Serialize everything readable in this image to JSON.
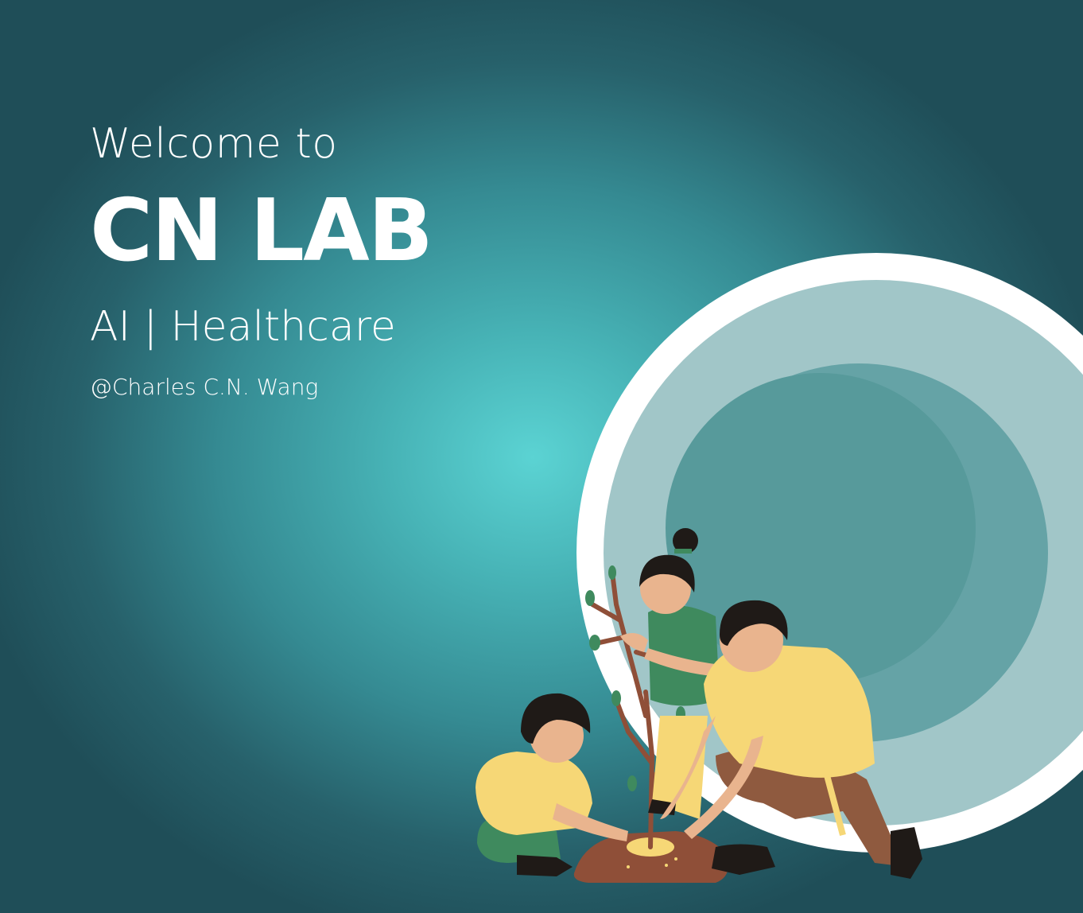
{
  "hero": {
    "welcome": "Welcome to",
    "brand": "CN LAB",
    "subtitle": "AI | Healthcare",
    "credit": "@Charles C.N. Wang"
  },
  "colors": {
    "background_center": "#5bd3d3",
    "background_edge": "#1f4e58",
    "text": "#ffffff",
    "ring_outer": "#ffffff",
    "ring_middle": "#a1c6c8",
    "ring_inner": "#65a3a6",
    "ring_core": "#579a9b",
    "shirt_yellow": "#f6d776",
    "shirt_green": "#3f8a5e",
    "pants_brown": "#8f5a3f",
    "skin": "#e9b48e",
    "hair": "#1f1a17",
    "soil": "#8f4f38"
  },
  "illustration": {
    "subject": "family-planting-tree-illustration"
  }
}
